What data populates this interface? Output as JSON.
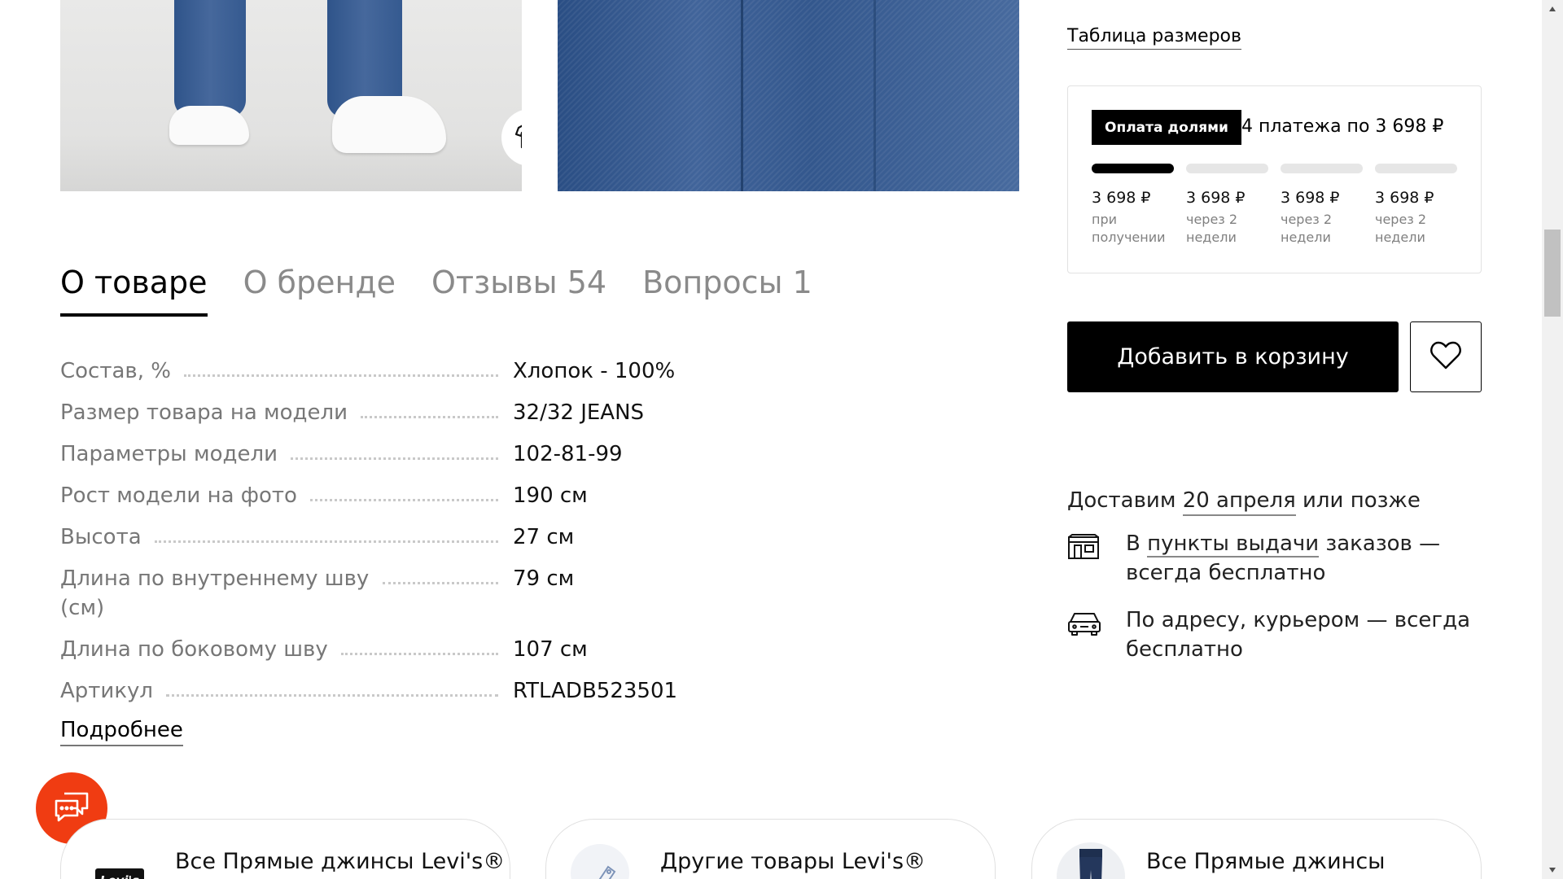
{
  "tabs": [
    {
      "label": "О товаре"
    },
    {
      "label": "О бренде"
    },
    {
      "label": "Отзывы 54"
    },
    {
      "label": "Вопросы 1"
    }
  ],
  "attributes": [
    {
      "key": "Состав, %",
      "value": "Хлопок - 100%"
    },
    {
      "key": "Размер товара на модели",
      "value": "32/32 JEANS"
    },
    {
      "key": "Параметры модели",
      "value": "102-81-99"
    },
    {
      "key": "Рост модели на фото",
      "value": "190 см"
    },
    {
      "key": "Высота",
      "value": "27 см"
    },
    {
      "key": "Длина по внутреннему шву (см)",
      "value": "79 см"
    },
    {
      "key": "Длина по боковому шву",
      "value": "107 см"
    },
    {
      "key": "Артикул",
      "value": "RTLADB523501"
    }
  ],
  "more_label": "Подробнее",
  "size_table_label": "Таблица размеров",
  "installments": {
    "badge": "Оплата долями",
    "summary": "4 платежа по 3 698 ₽",
    "progress_paid": 1,
    "progress_total": 4,
    "payments": [
      {
        "amount": "3 698 ₽",
        "when": "при получении"
      },
      {
        "amount": "3 698 ₽",
        "when": "через 2 недели"
      },
      {
        "amount": "3 698 ₽",
        "when": "через 2 недели"
      },
      {
        "amount": "3 698 ₽",
        "when": "через 2 недели"
      }
    ]
  },
  "cart_label": "Добавить в корзину",
  "delivery": {
    "title_prefix": "Доставим ",
    "title_link": "20 апреля",
    "title_suffix": " или позже",
    "pickup_prefix": "В ",
    "pickup_link": "пункты выдачи",
    "pickup_suffix": " заказов — всегда бесплатно",
    "courier": "По адресу, курьером — всегда бесплатно"
  },
  "cards": [
    {
      "title": "Все Прямые джинсы Levi's®",
      "logo_text": "Levi's"
    },
    {
      "title": "Другие товары Levi's®"
    },
    {
      "title": "Все Прямые джинсы"
    }
  ],
  "colors": {
    "accent_chat": "#f03c12",
    "primary": "#000000",
    "muted_text": "#777777"
  },
  "icons": [
    "tryon-tshirt-icon",
    "heart-icon",
    "pickup-point-icon",
    "courier-car-icon",
    "chat-icon",
    "price-tag-icon"
  ]
}
